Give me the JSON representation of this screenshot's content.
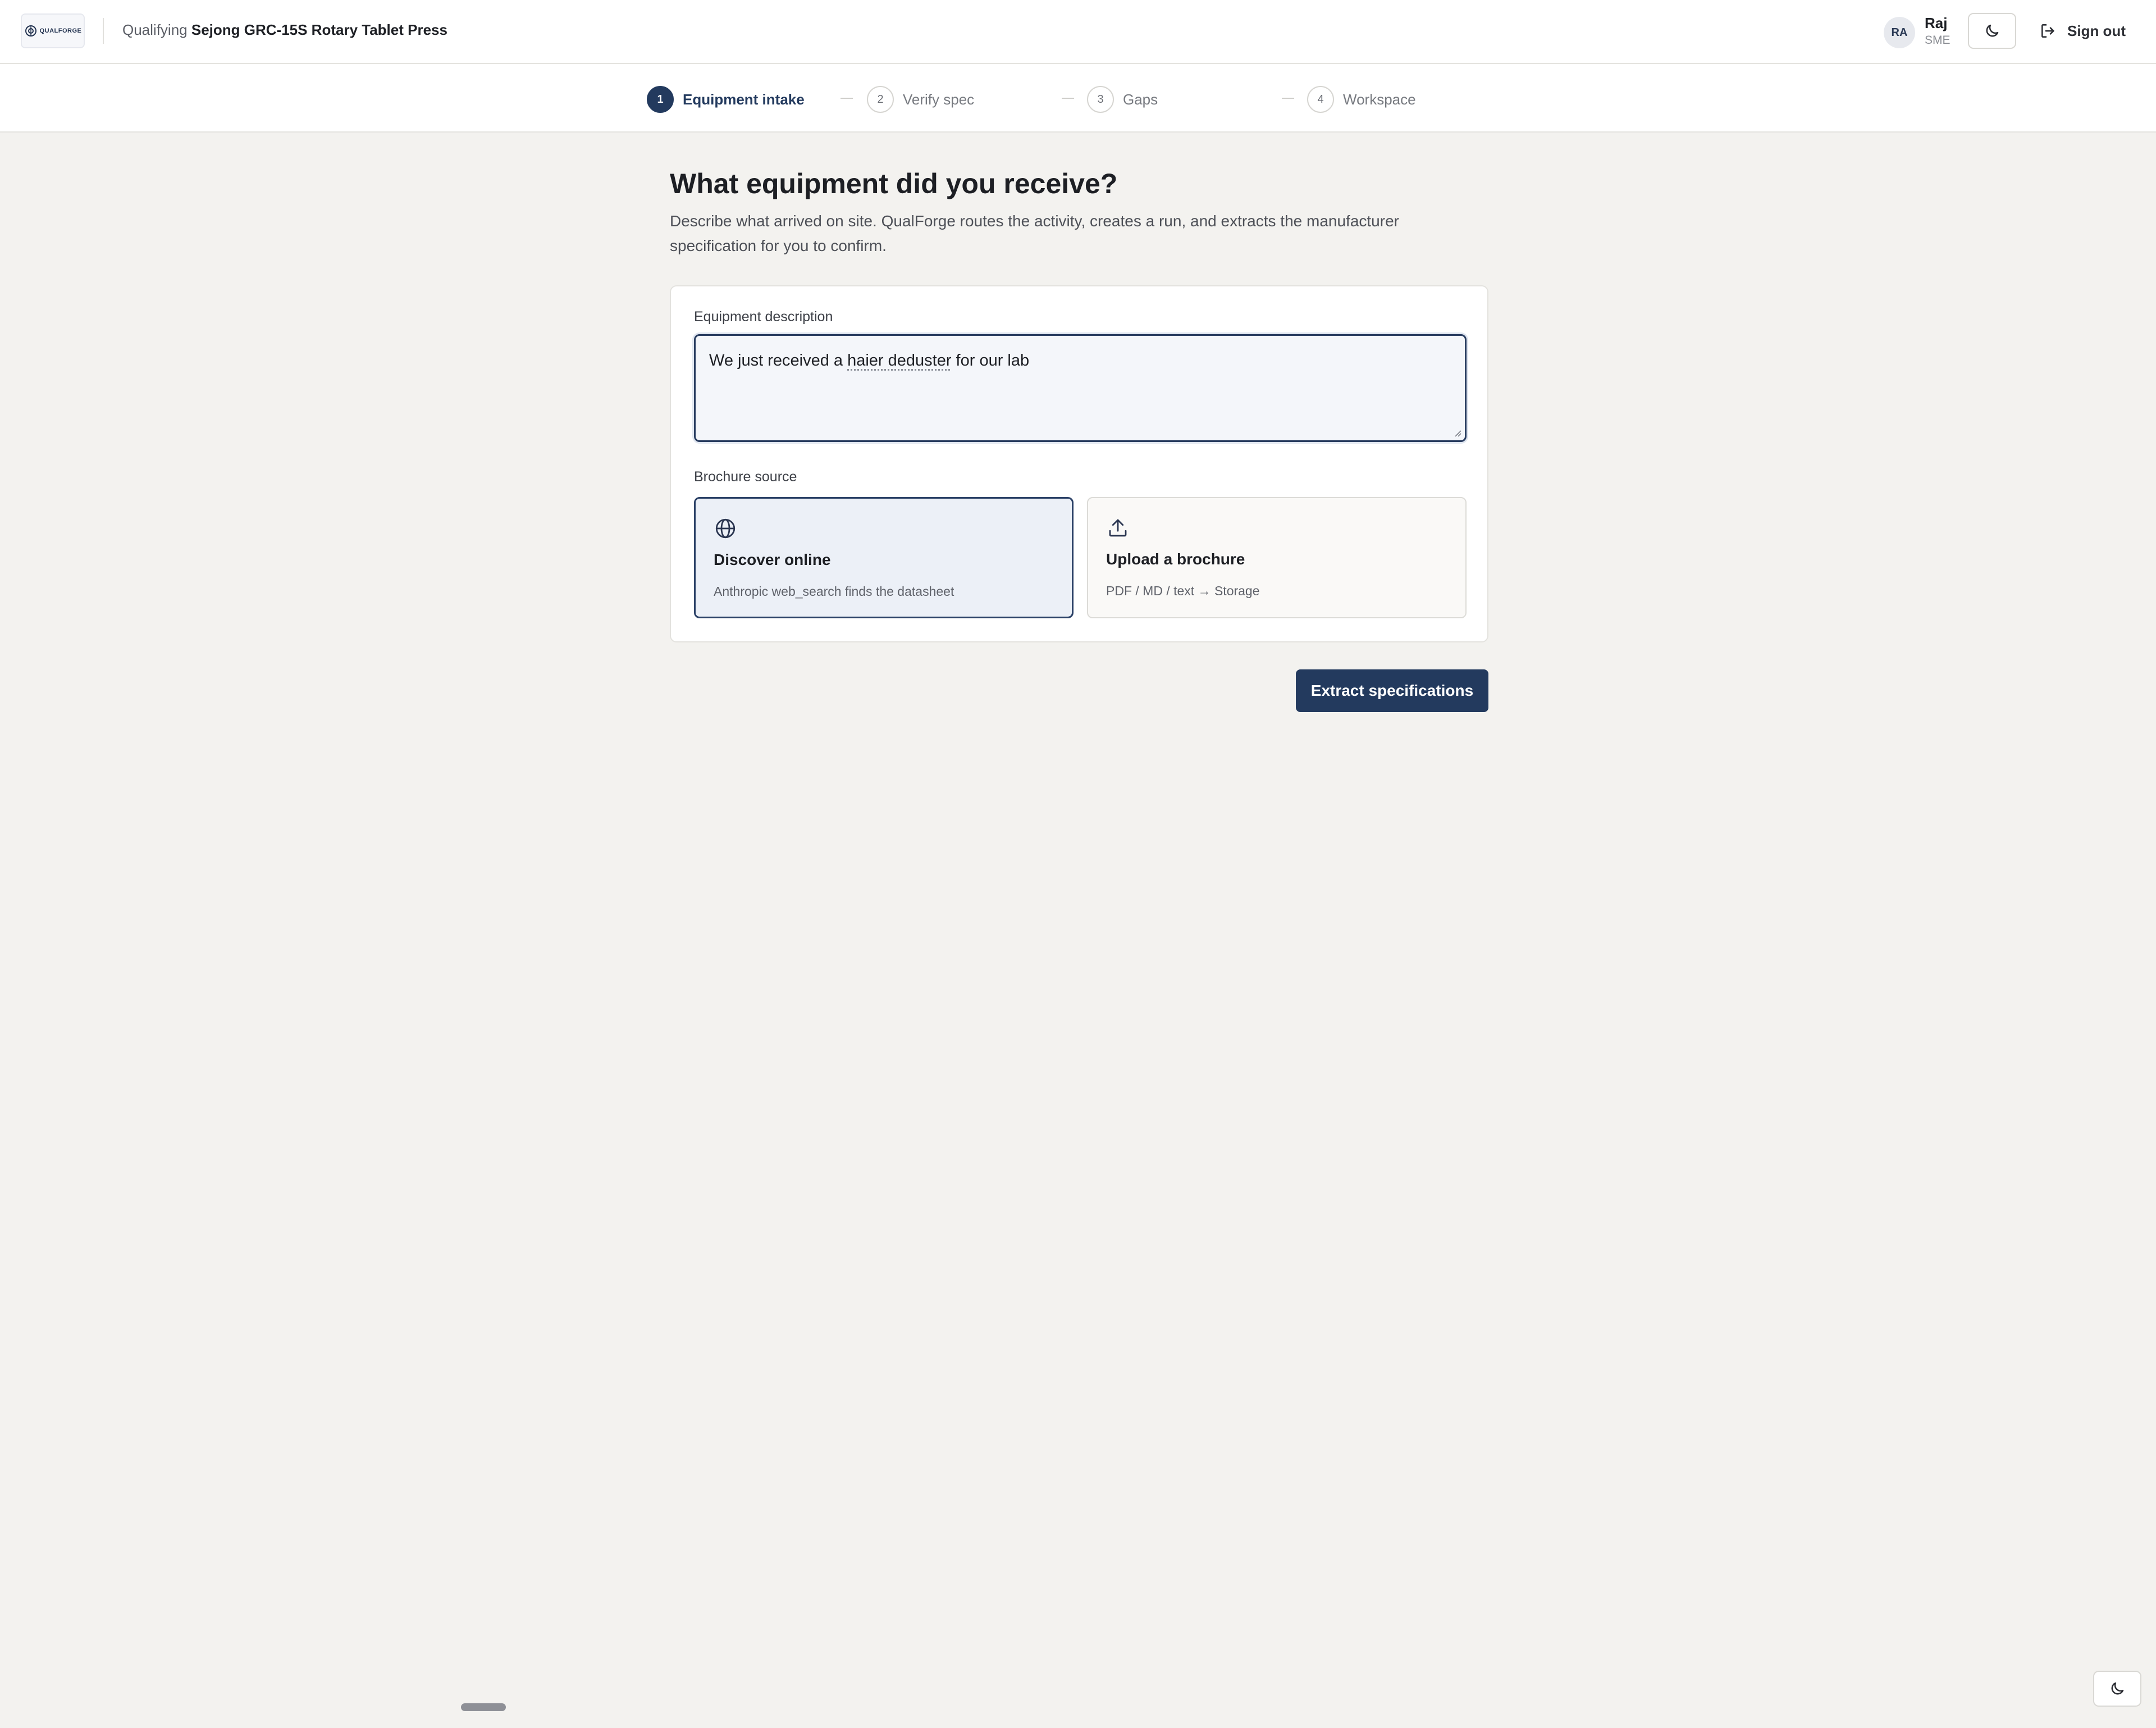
{
  "header": {
    "logo_text": "QUALFORGE",
    "crumb_prefix": "Qualifying",
    "crumb_equipment": "Sejong GRC-15S Rotary Tablet Press",
    "user": {
      "initials": "RA",
      "name": "Raj",
      "role": "SME"
    },
    "signout_label": "Sign out"
  },
  "stepper": {
    "steps": [
      {
        "num": "1",
        "label": "Equipment intake",
        "active": true
      },
      {
        "num": "2",
        "label": "Verify spec",
        "active": false
      },
      {
        "num": "3",
        "label": "Gaps",
        "active": false
      },
      {
        "num": "4",
        "label": "Workspace",
        "active": false
      }
    ]
  },
  "main": {
    "title": "What equipment did you receive?",
    "lede": "Describe what arrived on site. QualForge routes the activity, creates a run, and extracts the manufacturer specification for you to confirm.",
    "description_label": "Equipment description",
    "description_value_before": "We just received a ",
    "description_value_flagged": "haier deduster",
    "description_value_after": " for our lab",
    "brochure_label": "Brochure source",
    "sources": [
      {
        "title": "Discover online",
        "subtitle": "Anthropic web_search finds the datasheet",
        "icon": "globe-icon",
        "selected": true
      },
      {
        "title": "Upload a brochure",
        "subtitle": "PDF / MD / text → Storage",
        "icon": "upload-icon",
        "selected": false
      }
    ],
    "submit_label": "Extract specifications"
  },
  "colors": {
    "accent": "#233a5e",
    "page_bg": "#f3f2ef",
    "card_bg": "#ffffff",
    "selected_bg": "#ecf0f7"
  }
}
